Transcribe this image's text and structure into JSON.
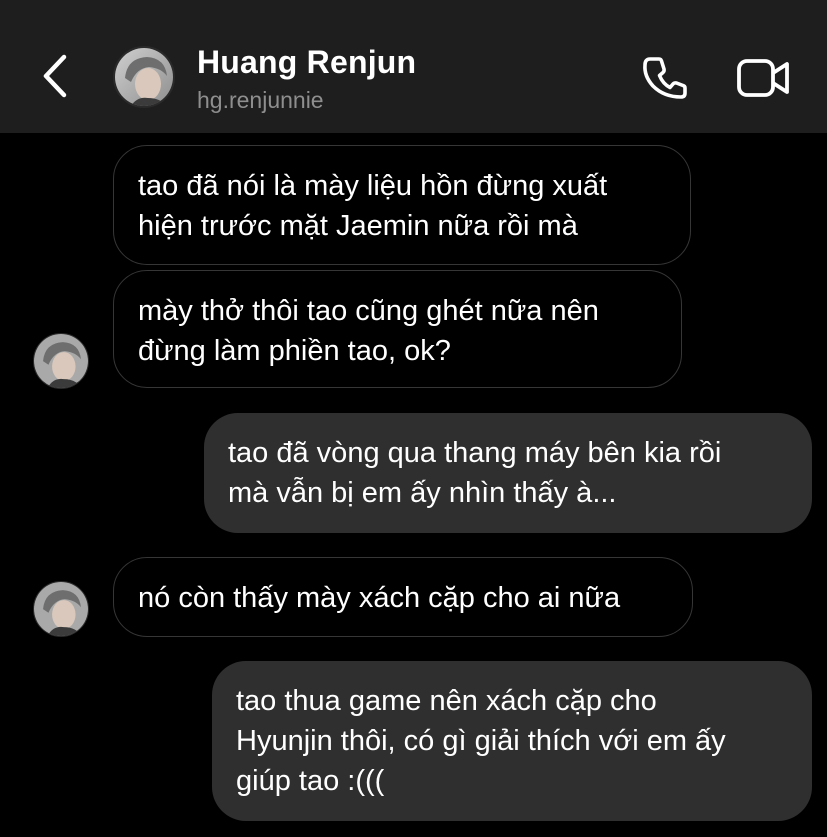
{
  "header": {
    "contact_name": "Huang Renjun",
    "contact_handle": "hg.renjunnie"
  },
  "icons": {
    "back": "chevron-left-icon",
    "call": "phone-icon",
    "video": "video-camera-icon",
    "avatar": "profile-photo"
  },
  "colors": {
    "background": "#000000",
    "header_bg": "#1e1e1e",
    "outgoing_bubble": "#2f2f2f",
    "incoming_border": "#363636",
    "handle_text": "#8e8e8e"
  },
  "messages": [
    {
      "direction": "incoming",
      "lines": [
        "tao đã nói là mày liệu hồn đừng xuất",
        "hiện trước mặt Jaemin nữa rồi mà"
      ]
    },
    {
      "direction": "incoming",
      "lines": [
        "mày thở thôi tao cũng ghét nữa nên",
        "đừng làm phiền tao, ok?"
      ]
    },
    {
      "direction": "outgoing",
      "lines": [
        "tao đã vòng qua thang máy bên kia rồi",
        "mà vẫn bị em ấy nhìn thấy à..."
      ]
    },
    {
      "direction": "incoming",
      "lines": [
        "nó còn thấy mày xách cặp cho ai nữa"
      ]
    },
    {
      "direction": "outgoing",
      "lines": [
        "tao thua game nên xách cặp cho",
        "Hyunjin thôi, có gì giải thích với em ấy",
        "giúp tao :((("
      ]
    }
  ]
}
